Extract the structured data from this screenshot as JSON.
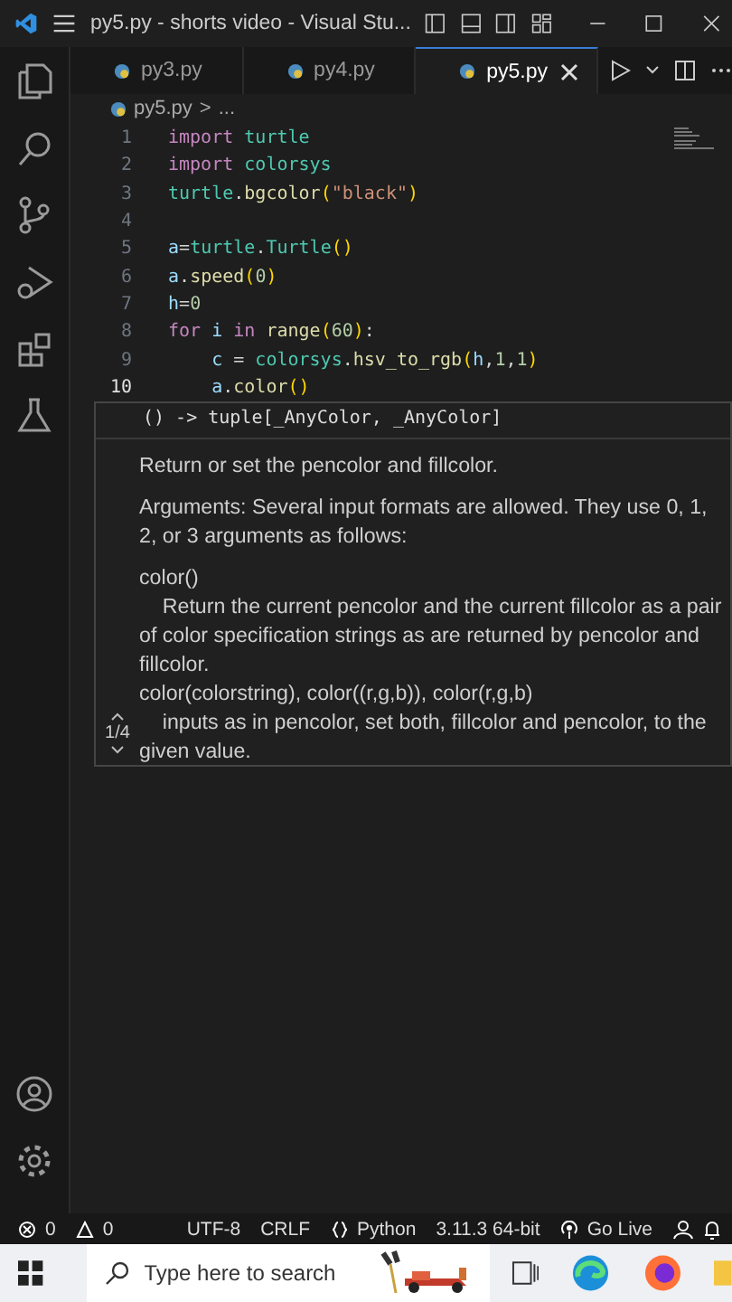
{
  "window": {
    "title": "py5.py - shorts video - Visual Stu..."
  },
  "tabs": [
    {
      "label": "py3.py",
      "selected": false
    },
    {
      "label": "py4.py",
      "selected": false
    },
    {
      "label": "py5.py",
      "selected": true
    }
  ],
  "breadcrumb": [
    "py5.py",
    ">",
    "..."
  ],
  "code_lines": [
    {
      "number": "1",
      "current": false,
      "tokens": [
        {
          "kind": "keyword",
          "text": "import "
        },
        {
          "kind": "module",
          "text": "turtle"
        }
      ]
    },
    {
      "number": "2",
      "current": false,
      "tokens": [
        {
          "kind": "keyword",
          "text": "import "
        },
        {
          "kind": "module",
          "text": "colorsys"
        }
      ]
    },
    {
      "number": "3",
      "current": false,
      "tokens": [
        {
          "kind": "module",
          "text": "turtle"
        },
        {
          "kind": "plain",
          "text": "."
        },
        {
          "kind": "func",
          "text": "bgcolor"
        },
        {
          "kind": "bracket",
          "text": "("
        },
        {
          "kind": "string",
          "text": "\"black\""
        },
        {
          "kind": "bracket",
          "text": ")"
        }
      ]
    },
    {
      "number": "4",
      "current": false
    },
    {
      "number": "5",
      "current": false,
      "tokens": [
        {
          "kind": "var",
          "text": "a"
        },
        {
          "kind": "plain",
          "text": "="
        },
        {
          "kind": "module",
          "text": "turtle"
        },
        {
          "kind": "plain",
          "text": "."
        },
        {
          "kind": "module",
          "text": "Turtle"
        },
        {
          "kind": "bracket",
          "text": "()"
        }
      ]
    },
    {
      "number": "6",
      "current": false,
      "tokens": [
        {
          "kind": "var",
          "text": "a"
        },
        {
          "kind": "plain",
          "text": "."
        },
        {
          "kind": "func",
          "text": "speed"
        },
        {
          "kind": "bracket",
          "text": "("
        },
        {
          "kind": "number",
          "text": "0"
        },
        {
          "kind": "bracket",
          "text": ")"
        }
      ]
    },
    {
      "number": "7",
      "current": false,
      "tokens": [
        {
          "kind": "var",
          "text": "h"
        },
        {
          "kind": "plain",
          "text": "="
        },
        {
          "kind": "number",
          "text": "0"
        }
      ]
    },
    {
      "number": "8",
      "current": false,
      "tokens": [
        {
          "kind": "keyword",
          "text": "for "
        },
        {
          "kind": "var",
          "text": "i "
        },
        {
          "kind": "keyword",
          "text": "in "
        },
        {
          "kind": "func",
          "text": "range"
        },
        {
          "kind": "bracket",
          "text": "("
        },
        {
          "kind": "number",
          "text": "60"
        },
        {
          "kind": "bracket",
          "text": ")"
        },
        {
          "kind": "plain",
          "text": ":"
        }
      ]
    },
    {
      "number": "9",
      "current": false,
      "tokens": [
        {
          "kind": "var",
          "text": "    c"
        },
        {
          "kind": "plain",
          "text": " = "
        },
        {
          "kind": "module",
          "text": "colorsys"
        },
        {
          "kind": "plain",
          "text": "."
        },
        {
          "kind": "func",
          "text": "hsv_to_rgb"
        },
        {
          "kind": "bracket",
          "text": "("
        },
        {
          "kind": "var",
          "text": "h"
        },
        {
          "kind": "plain",
          "text": ","
        },
        {
          "kind": "number",
          "text": "1"
        },
        {
          "kind": "plain",
          "text": ","
        },
        {
          "kind": "number",
          "text": "1"
        },
        {
          "kind": "bracket",
          "text": ")"
        }
      ]
    },
    {
      "number": "10",
      "current": true,
      "tokens": [
        {
          "kind": "var",
          "text": "    a"
        },
        {
          "kind": "plain",
          "text": "."
        },
        {
          "kind": "func",
          "text": "color"
        },
        {
          "kind": "bracket",
          "text": "()"
        }
      ]
    }
  ],
  "hover": {
    "signature": "() -> tuple[_AnyColor, _AnyColor]",
    "counter": "1/4",
    "paragraphs": [
      "Return or set the pencolor and fillcolor.",
      "Arguments: Several input formats are allowed. They use 0, 1, 2, or 3 arguments as follows:",
      "color()\n    Return the current pencolor and the current fillcolor as a pair of color specification strings as are returned by pencolor and fillcolor.\ncolor(colorstring), color((r,g,b)), color(r,g,b)\n    inputs as in pencolor, set both, fillcolor and pencolor, to the given value."
    ]
  },
  "status_bar": {
    "errors": "0",
    "warnings": "0",
    "encoding": "UTF-8",
    "line_ending": "CRLF",
    "language": "Python",
    "interpreter": "3.11.3 64-bit",
    "live": "Go Live"
  },
  "taskbar": {
    "search": {
      "placeholder": "Type here to search"
    }
  }
}
